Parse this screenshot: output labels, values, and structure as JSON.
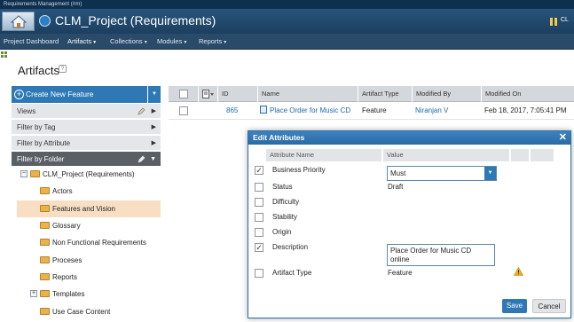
{
  "app_bar": {
    "title": "Requirements Management (/rm)"
  },
  "header": {
    "project_title": "CLM_Project (Requirements)",
    "right_label": "CL"
  },
  "nav": {
    "items": [
      {
        "label": "Project Dashboard"
      },
      {
        "label": "Artifacts"
      },
      {
        "label": "Collections"
      },
      {
        "label": "Modules"
      },
      {
        "label": "Reports"
      }
    ]
  },
  "page": {
    "title": "Artifacts",
    "help": "?"
  },
  "sidebar": {
    "create_label": "Create New Feature",
    "sections": [
      {
        "label": "Views"
      },
      {
        "label": "Filter by Tag"
      },
      {
        "label": "Filter by Attribute"
      },
      {
        "label": "Filter by Folder"
      }
    ],
    "tree": [
      {
        "label": "CLM_Project (Requirements)"
      },
      {
        "label": "Actors"
      },
      {
        "label": "Features and Vision"
      },
      {
        "label": "Glossary"
      },
      {
        "label": "Non Functional Requirements"
      },
      {
        "label": "Proceses"
      },
      {
        "label": "Reports"
      },
      {
        "label": "Templates"
      },
      {
        "label": "Use Case Content"
      }
    ]
  },
  "grid": {
    "columns": [
      "ID",
      "Name",
      "Artifact Type",
      "Modified By",
      "Modified On"
    ],
    "rows": [
      {
        "id": "865",
        "name": "Place Order for Music CD",
        "type": "Feature",
        "modified_by": "Niranjan V",
        "modified_on": "Feb 18, 2017, 7:05:41 PM"
      }
    ]
  },
  "dialog": {
    "title": "Edit Attributes",
    "close": "✕",
    "headers": {
      "name": "Attribute Name",
      "value": "Value"
    },
    "attributes": [
      {
        "name": "Business Priority",
        "value": "Must",
        "checked": true
      },
      {
        "name": "Status",
        "value": "Draft",
        "checked": false
      },
      {
        "name": "Difficulty",
        "value": "",
        "checked": false
      },
      {
        "name": "Stability",
        "value": "",
        "checked": false
      },
      {
        "name": "Origin",
        "value": "",
        "checked": false
      },
      {
        "name": "Description",
        "value": "Place Order for Music CD online",
        "checked": true
      },
      {
        "name": "Artifact Type",
        "value": "Feature",
        "checked": false
      }
    ],
    "save_label": "Save",
    "cancel_label": "Cancel"
  },
  "colors": {
    "accent": "#2e79b5",
    "nav_bg": "#2a4a6a",
    "selection": "#f8dfc3"
  }
}
